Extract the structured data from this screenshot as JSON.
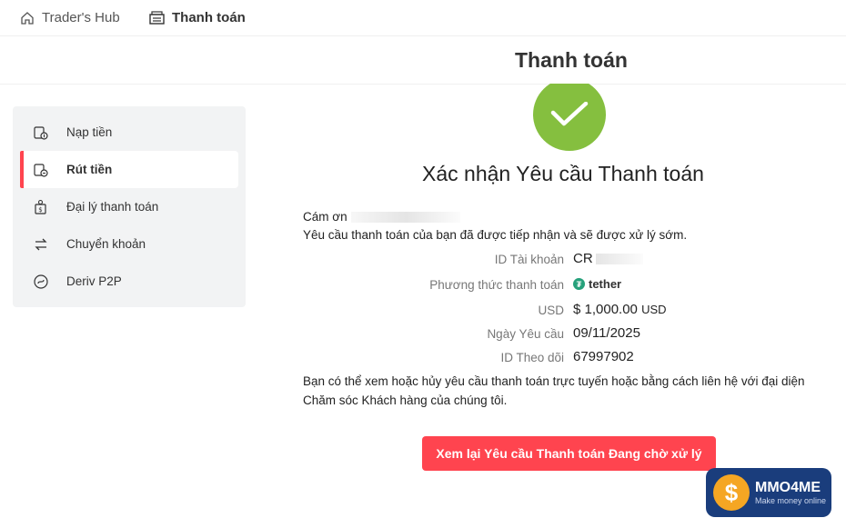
{
  "topnav": {
    "hub_label": "Trader's Hub",
    "payment_label": "Thanh toán"
  },
  "page": {
    "title": "Thanh toán"
  },
  "sidebar": {
    "items": [
      {
        "label": "Nạp tiền",
        "icon": "deposit-icon",
        "active": false
      },
      {
        "label": "Rút tiền",
        "icon": "withdraw-icon",
        "active": true
      },
      {
        "label": "Đại lý thanh toán",
        "icon": "payment-agent-icon",
        "active": false
      },
      {
        "label": "Chuyển khoản",
        "icon": "transfer-icon",
        "active": false
      },
      {
        "label": "Deriv P2P",
        "icon": "p2p-icon",
        "active": false
      }
    ]
  },
  "confirmation": {
    "title": "Xác nhận Yêu cầu Thanh toán",
    "greeting": "Cám ơn",
    "received": "Yêu cầu thanh toán của bạn đã được tiếp nhận và sẽ được xử lý sớm.",
    "details": {
      "account_label": "ID Tài khoản",
      "account_value": "CR",
      "method_label": "Phương thức thanh toán",
      "method_value": "tether",
      "currency_label": "USD",
      "amount_value": "$ 1,000.00",
      "amount_currency": "USD",
      "date_label": "Ngày Yêu cầu",
      "date_value": "09/11/2025",
      "tracking_label": "ID Theo dõi",
      "tracking_value": "67997902"
    },
    "note": "Bạn có thể xem hoặc hủy yêu cầu thanh toán trực tuyến hoặc bằng cách liên hệ với đại diện Chăm sóc Khách hàng của chúng tôi.",
    "review_button": "Xem lại Yêu cầu Thanh toán Đang chờ xử lý"
  },
  "watermark": {
    "brand": "MMO4ME",
    "tagline": "Make money online"
  },
  "colors": {
    "accent": "#ff444f",
    "success": "#85bf3f",
    "sidebar_bg": "#f2f3f4",
    "tether": "#26a17b"
  }
}
